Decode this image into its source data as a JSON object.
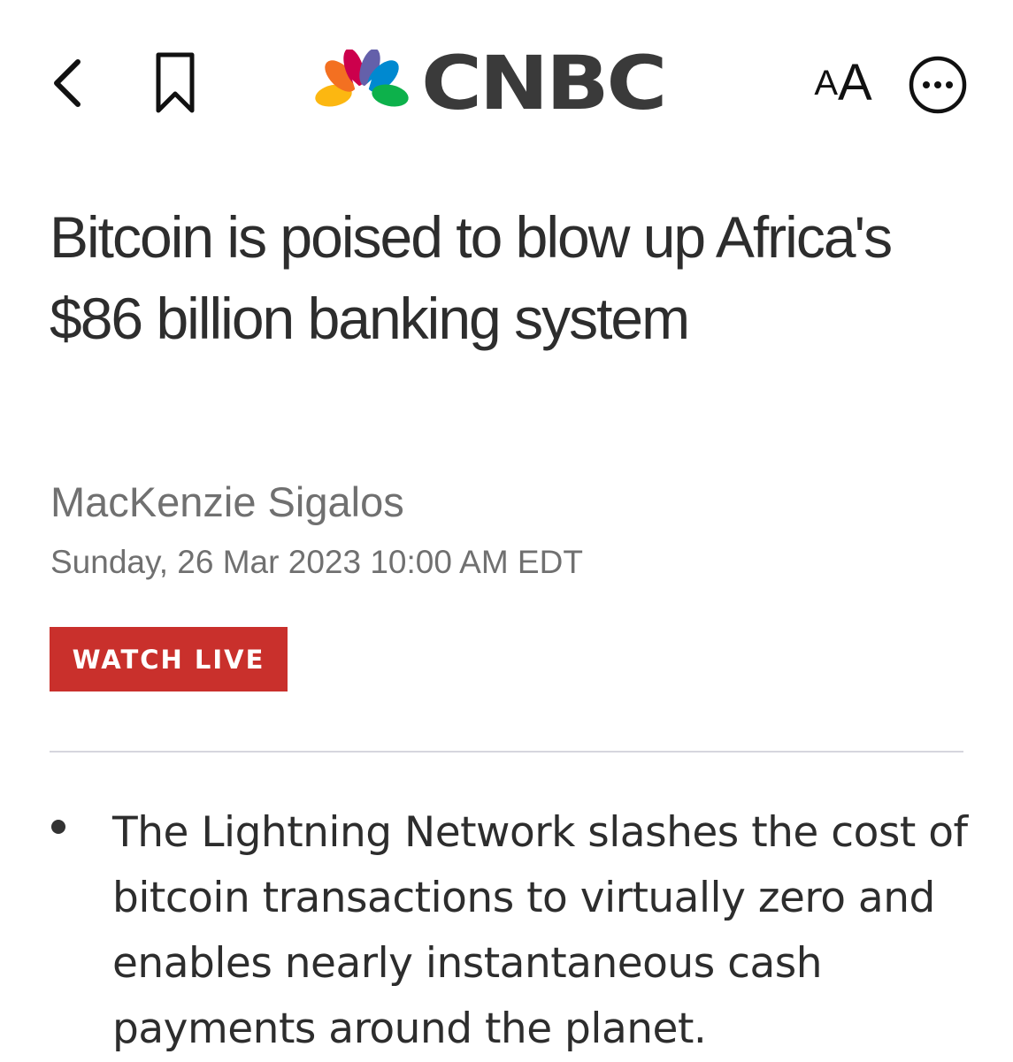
{
  "header": {
    "back_icon": "chevron-left-icon",
    "bookmark_icon": "bookmark-icon",
    "logo_text": "CNBC",
    "font_size_small": "A",
    "font_size_big": "A",
    "more_icon": "more-options-icon"
  },
  "article": {
    "headline": "Bitcoin is poised to blow up Africa's $86 billion banking system",
    "author": "MacKenzie Sigalos",
    "date": "Sunday, 26 Mar 2023 10:00 AM EDT",
    "watch_live_label": "WATCH LIVE",
    "key_points": [
      "The Lightning Network slashes the cost of bitcoin transactions to virtually zero and enables nearly instantaneous cash payments around the planet."
    ]
  },
  "colors": {
    "watch_live_bg": "#c9302c",
    "peacock": [
      "#fcb711",
      "#f37021",
      "#cc004c",
      "#6460aa",
      "#0089d0",
      "#0db14b"
    ],
    "logo_text": "#3a3a3a"
  }
}
